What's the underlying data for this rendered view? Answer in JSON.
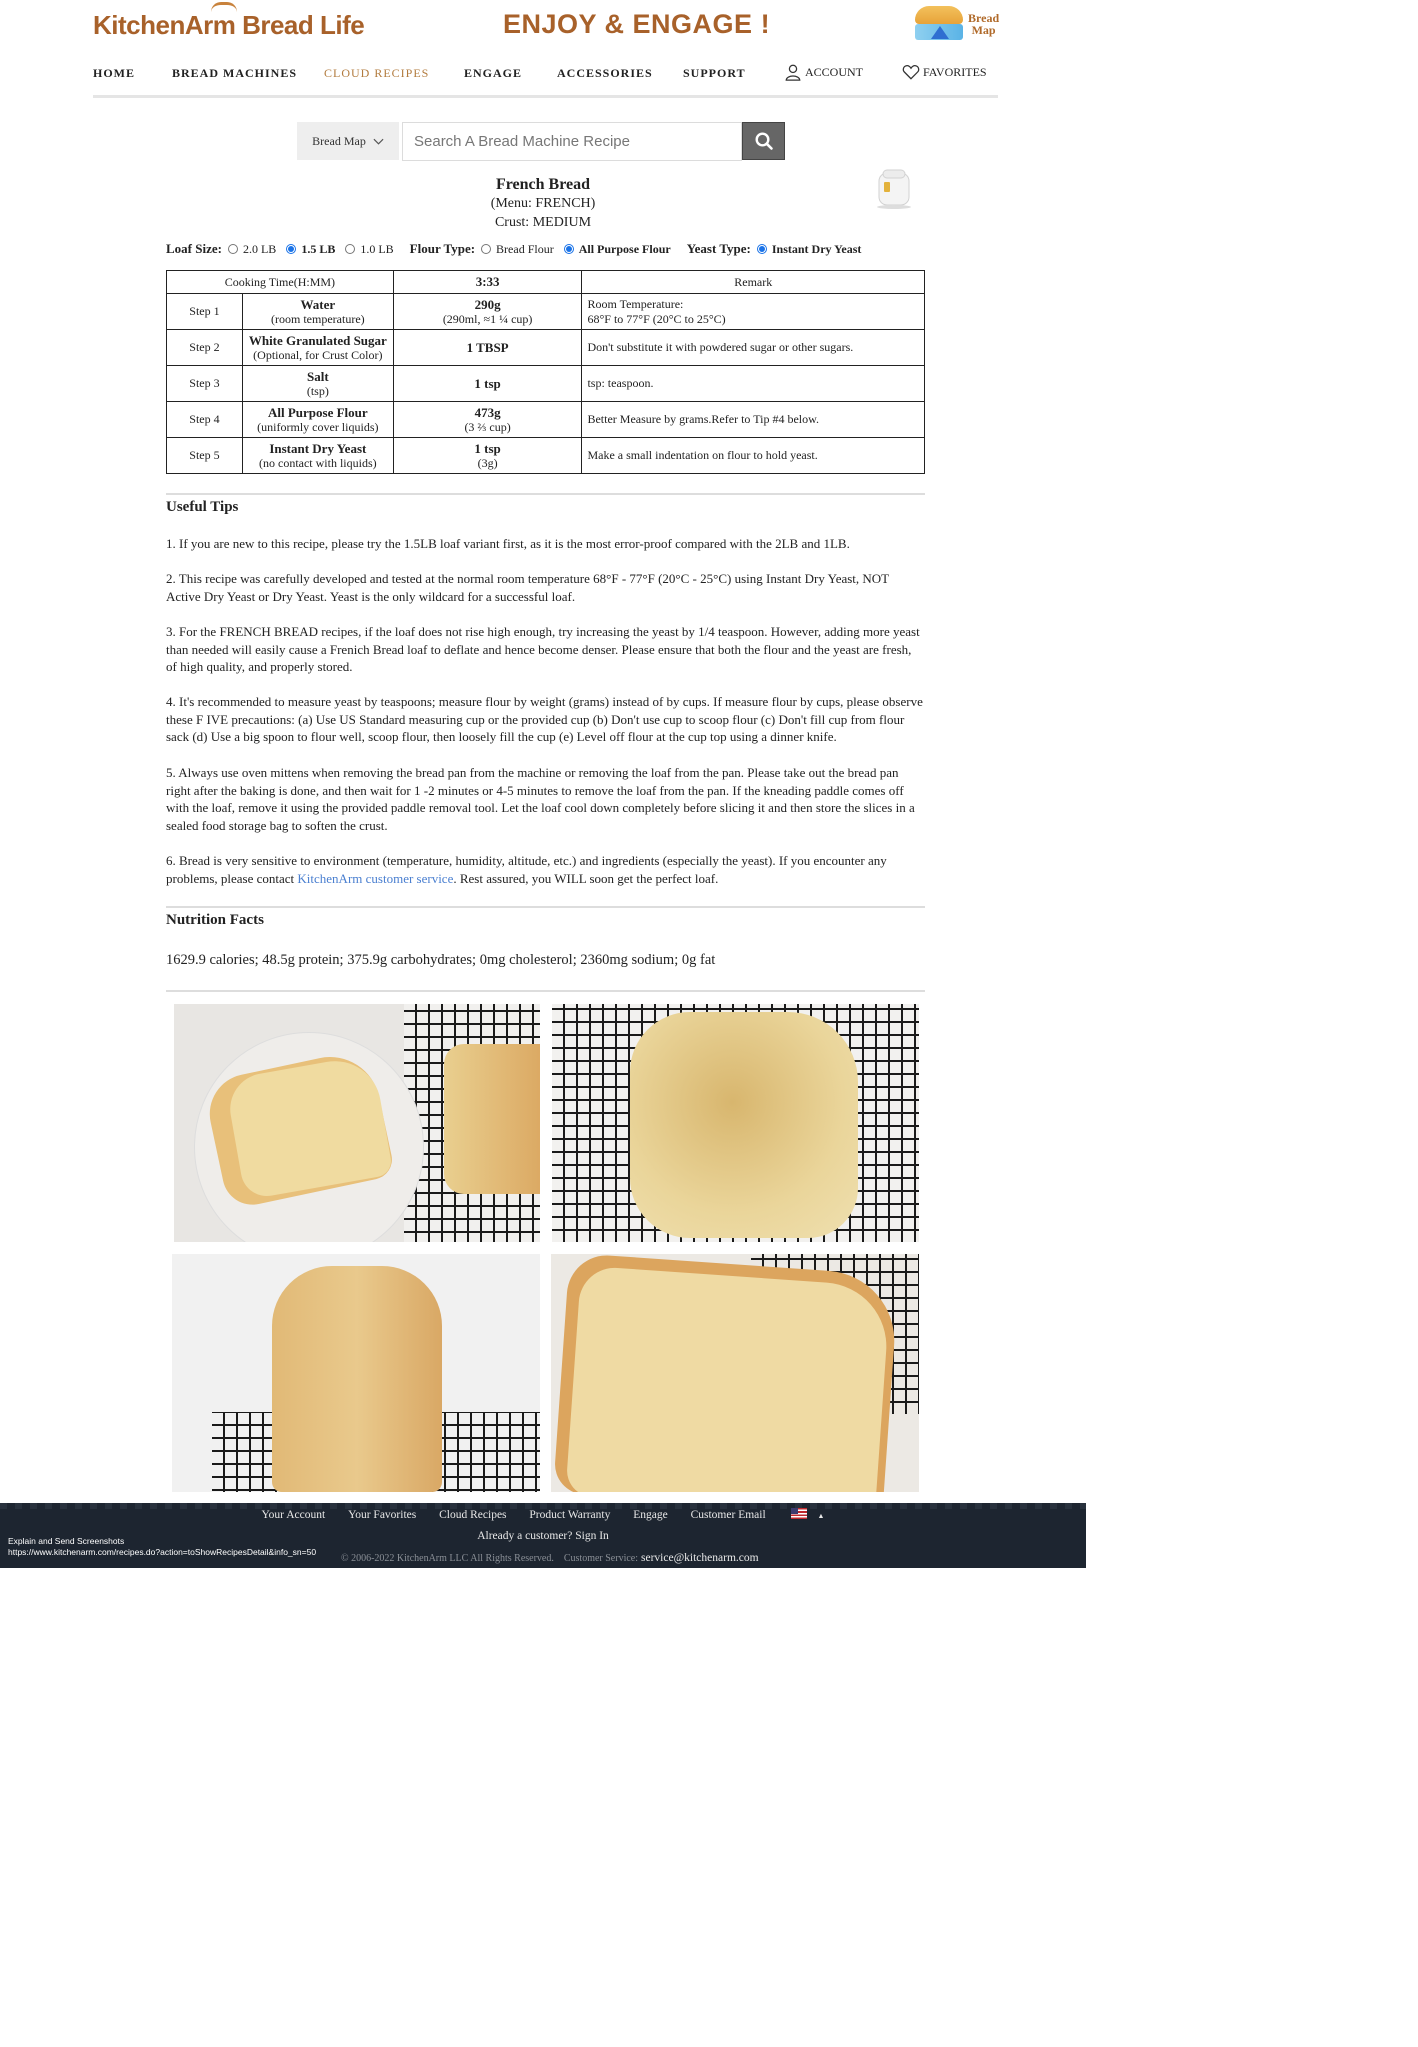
{
  "header": {
    "logo": "KitchenArm Bread Life",
    "tagline": "ENJOY & ENGAGE !",
    "bread_map_badge": "Bread\nMap"
  },
  "nav": {
    "items": [
      "HOME",
      "BREAD MACHINES",
      "CLOUD RECIPES",
      "ENGAGE",
      "ACCESSORIES",
      "SUPPORT"
    ],
    "active": "CLOUD RECIPES",
    "account": "ACCOUNT",
    "favorites": "FAVORITES"
  },
  "search": {
    "select_label": "Bread Map",
    "placeholder": "Search A Bread Machine Recipe"
  },
  "recipe": {
    "title": "French Bread",
    "menu": "(Menu: FRENCH)",
    "crust": "Crust: MEDIUM"
  },
  "options": {
    "loaf_label": "Loaf Size:",
    "loaf_sizes": [
      {
        "label": "2.0 LB",
        "checked": false
      },
      {
        "label": "1.5 LB",
        "checked": true
      },
      {
        "label": "1.0 LB",
        "checked": false
      }
    ],
    "flour_label": "Flour Type:",
    "flour_types": [
      {
        "label": "Bread Flour",
        "checked": false
      },
      {
        "label": "All Purpose Flour",
        "checked": true
      }
    ],
    "yeast_label": "Yeast Type:",
    "yeast_types": [
      {
        "label": "Instant Dry Yeast",
        "checked": true
      }
    ]
  },
  "table": {
    "header": {
      "cooking_time_label": "Cooking Time(H:MM)",
      "cooking_time": "3:33",
      "remark": "Remark"
    },
    "steps": [
      {
        "step": "Step 1",
        "name": "Water",
        "note": "(room temperature)",
        "amount": "290g",
        "amount_sub": "(290ml, ≈1 ¼ cup)",
        "remark": "Room Temperature:\n68°F to 77°F (20°C to 25°C)"
      },
      {
        "step": "Step 2",
        "name": "White Granulated Sugar",
        "note": "(Optional, for Crust Color)",
        "amount": "1 TBSP",
        "amount_sub": "",
        "remark": "Don't substitute it with powdered sugar or other sugars."
      },
      {
        "step": "Step 3",
        "name": "Salt",
        "note": "(tsp)",
        "amount": "1 tsp",
        "amount_sub": "",
        "remark": "tsp: teaspoon."
      },
      {
        "step": "Step 4",
        "name": "All Purpose Flour",
        "note": "(uniformly cover liquids)",
        "amount": "473g",
        "amount_sub": "(3 ⅔ cup)",
        "remark": "Better Measure by grams.Refer to Tip #4 below."
      },
      {
        "step": "Step 5",
        "name": "Instant Dry Yeast",
        "note": "(no contact with liquids)",
        "amount": "1 tsp",
        "amount_sub": "(3g)",
        "remark": "Make a small indentation on flour to hold yeast."
      }
    ]
  },
  "tips": {
    "heading": "Useful Tips",
    "items": [
      "1. If you are new to this recipe, please try the 1.5LB loaf variant first, as it is the most error-proof compared with the 2LB and 1LB.",
      "2. This recipe was carefully developed and tested at the normal room temperature 68°F - 77°F (20°C - 25°C) using Instant Dry Yeast, NOT Active Dry Yeast or Dry Yeast. Yeast is the only wildcard for a successful loaf.",
      "3. For the FRENCH BREAD recipes, if the loaf does not rise high enough, try increasing the yeast by 1/4 teaspoon. However, adding more yeast than needed will easily cause a Frenich Bread loaf to deflate and hence become denser. Please ensure that both the flour and the yeast are fresh, of high quality, and properly stored.",
      "4. It's recommended to measure yeast by teaspoons; measure flour by weight (grams) instead of by cups. If measure flour by cups, please observe these F IVE precautions: (a) Use US Standard measuring cup or the provided cup (b) Don't use cup to scoop flour (c) Don't fill cup from flour sack (d) Use a big spoon to flour well, scoop flour, then loosely fill the cup (e) Level off flour at the cup top using a dinner knife.",
      "5. Always use oven mittens when removing the bread pan from the machine or removing the loaf from the pan. Please take out the bread pan right after the baking is done, and then wait for 1 -2 minutes or 4-5 minutes to remove the loaf from the pan. If the kneading paddle comes off with the loaf, remove it using the provided paddle removal tool. Let the loaf cool down completely before slicing it and then store the slices in a sealed food storage bag to soften the crust."
    ],
    "tip6_before": "6. Bread is very sensitive to environment (temperature, humidity, altitude, etc.) and ingredients (especially the yeast). If you encounter any problems, please contact ",
    "tip6_link": "KitchenArm customer service",
    "tip6_after": ". Rest assured, you WILL soon get the perfect loaf."
  },
  "nutrition": {
    "heading": "Nutrition Facts",
    "text": "1629.9 calories; 48.5g protein; 375.9g carbohydrates; 0mg cholesterol; 2360mg sodium; 0g fat"
  },
  "footer": {
    "links": [
      "Your Account",
      "Your Favorites",
      "Cloud Recipes",
      "Product Warranty",
      "Engage",
      "Customer Email"
    ],
    "signin": "Already a customer? Sign In",
    "copyright": "© 2006-2022 KitchenArm LLC All Rights Reserved.",
    "service_label": "Customer Service:",
    "service_email": "service@kitchenarm.com"
  },
  "overlay": {
    "line1": "Explain and Send Screenshots",
    "line2": "https://www.kitchenarm.com/recipes.do?action=toShowRecipesDetail&info_sn=50"
  }
}
